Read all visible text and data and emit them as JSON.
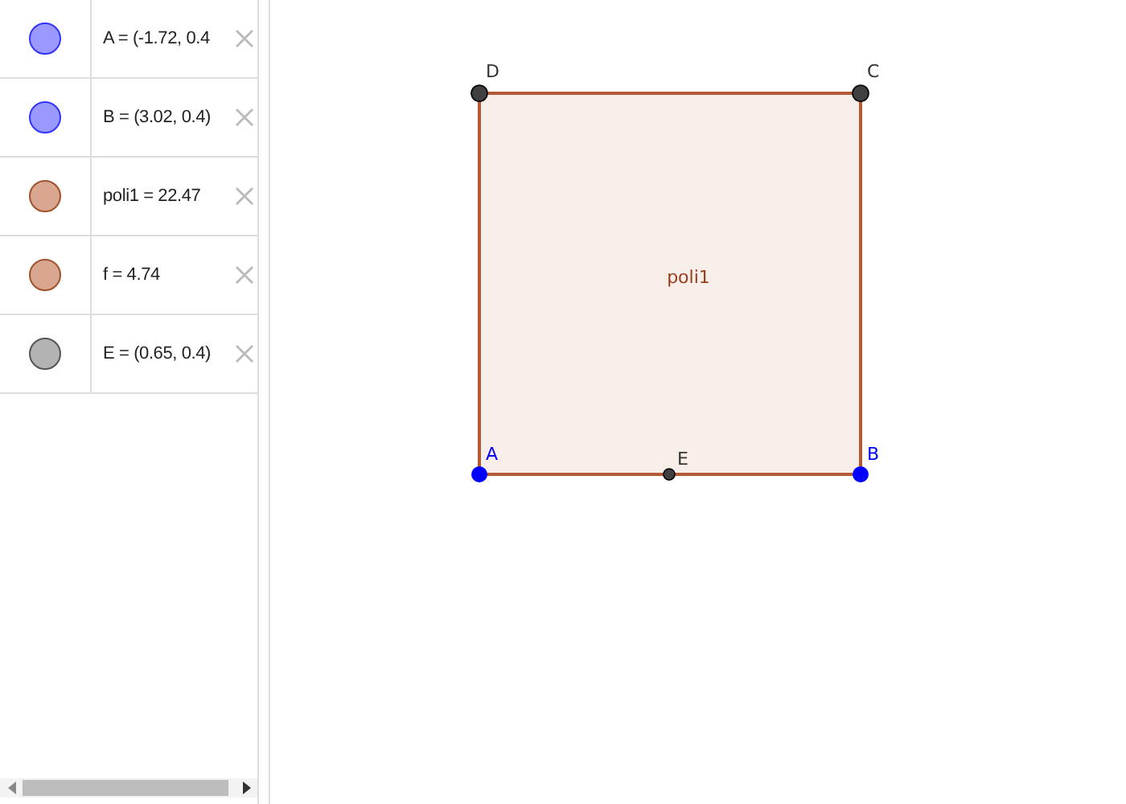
{
  "algebra_view": {
    "items": [
      {
        "text": "A = (-1.72, 0.4",
        "color": "#9999ff"
      },
      {
        "text": "B = (3.02, 0.4)",
        "color": "#9999ff"
      },
      {
        "text": "poli1 = 22.47",
        "color": "#d9a690"
      },
      {
        "text": "f = 4.74",
        "color": "#d9a690"
      },
      {
        "text": "E = (0.65, 0.4)",
        "color": "#b3b3b3"
      }
    ]
  },
  "graphics_view": {
    "polygon": {
      "label": "poli1",
      "color": "#b25b34"
    },
    "points": [
      {
        "name": "D",
        "color": "#404040",
        "kind": "free"
      },
      {
        "name": "C",
        "color": "#404040",
        "kind": "free"
      },
      {
        "name": "A",
        "color": "#0000ff",
        "kind": "free"
      },
      {
        "name": "E",
        "color": "#404040",
        "kind": "on_path"
      },
      {
        "name": "B",
        "color": "#0000ff",
        "kind": "free"
      }
    ]
  }
}
